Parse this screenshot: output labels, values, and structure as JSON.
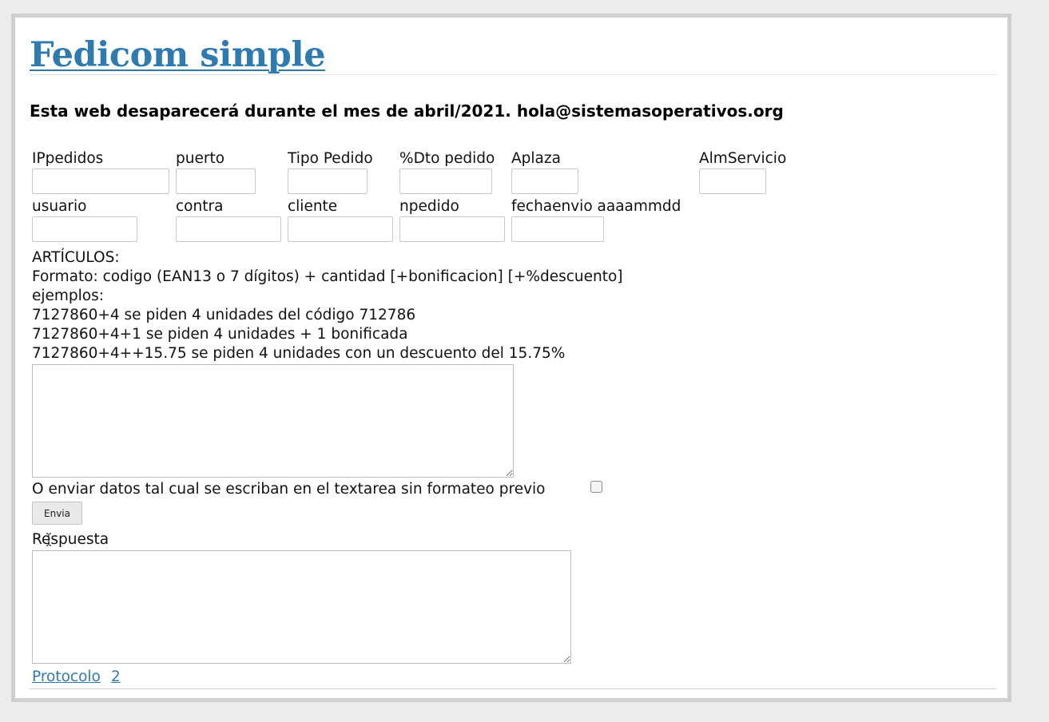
{
  "site": {
    "title": "Fedicom simple",
    "notice": "Esta web desaparecerá durante el mes de abril/2021. hola@sistemasoperativos.org"
  },
  "form": {
    "row1": [
      {
        "label": "IPpedidos",
        "value": ""
      },
      {
        "label": "puerto",
        "value": ""
      },
      {
        "label": "Tipo Pedido",
        "value": ""
      },
      {
        "label": "%Dto pedido",
        "value": ""
      },
      {
        "label": "Aplaza",
        "value": ""
      },
      {
        "label": "AlmServicio",
        "value": ""
      }
    ],
    "row2": [
      {
        "label": "usuario",
        "value": ""
      },
      {
        "label": "contra",
        "value": ""
      },
      {
        "label": "cliente",
        "value": ""
      },
      {
        "label": "npedido",
        "value": ""
      },
      {
        "label": "fechaenvio aaaammdd",
        "value": ""
      }
    ]
  },
  "articles": {
    "heading": "ARTÍCULOS:",
    "format": "Formato: codigo (EAN13 o 7 dígitos) + cantidad [+bonificacion] [+%descuento]",
    "examples_label": "ejemplos:",
    "examples": [
      "7127860+4 se piden 4 unidades del código 712786",
      "7127860+4+1 se piden 4 unidades + 1 bonificada",
      "7127860+4++15.75 se piden 4 unidades con un descuento del 15.75%"
    ],
    "textarea_value": ""
  },
  "raw_option": {
    "label": "O enviar datos tal cual se escriban en el textarea sin formateo previo",
    "checked": false
  },
  "submit": {
    "label": "Envia"
  },
  "response": {
    "label": "Respuesta",
    "value": ""
  },
  "footer": {
    "links": [
      "Protocolo",
      "2"
    ]
  }
}
